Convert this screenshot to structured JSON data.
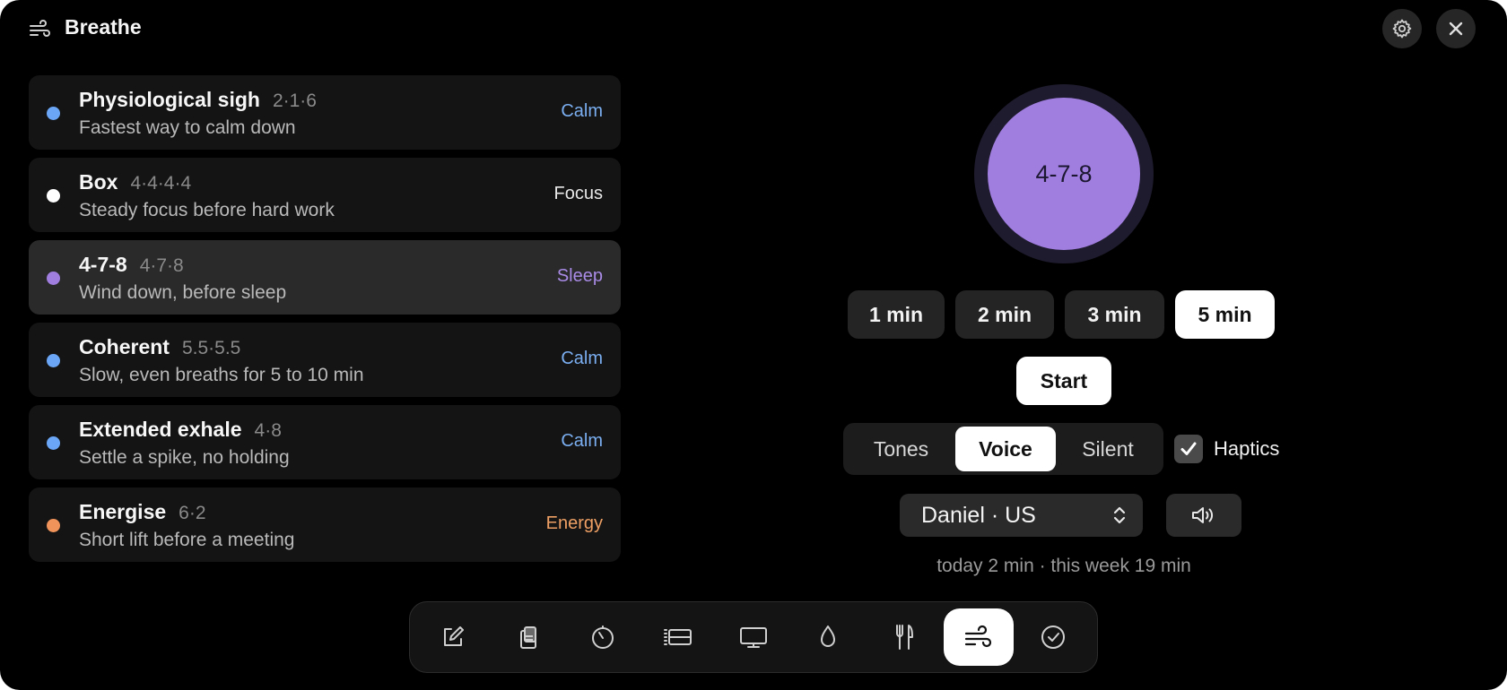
{
  "app": {
    "title": "Breathe",
    "icon": "wind-icon"
  },
  "header": {
    "settings_icon": "gear-icon",
    "close_icon": "close-icon"
  },
  "exercises": [
    {
      "name": "Physiological sigh",
      "pattern": "2·1·6",
      "description": "Fastest way to calm down",
      "tag": "Calm",
      "color": "#6aa6f5",
      "tag_color": "#7aaef0",
      "selected": false
    },
    {
      "name": "Box",
      "pattern": "4·4·4·4",
      "description": "Steady focus before hard work",
      "tag": "Focus",
      "color": "#ffffff",
      "tag_color": "#e8e8e8",
      "selected": false
    },
    {
      "name": "4-7-8",
      "pattern": "4·7·8",
      "description": "Wind down, before sleep",
      "tag": "Sleep",
      "color": "#a07ee0",
      "tag_color": "#a98be6",
      "selected": true
    },
    {
      "name": "Coherent",
      "pattern": "5.5·5.5",
      "description": "Slow, even breaths for 5 to 10 min",
      "tag": "Calm",
      "color": "#6aa6f5",
      "tag_color": "#7aaef0",
      "selected": false
    },
    {
      "name": "Extended exhale",
      "pattern": "4·8",
      "description": "Settle a spike, no holding",
      "tag": "Calm",
      "color": "#6aa6f5",
      "tag_color": "#7aaef0",
      "selected": false
    },
    {
      "name": "Energise",
      "pattern": "6·2",
      "description": "Short lift before a meeting",
      "tag": "Energy",
      "color": "#f0935a",
      "tag_color": "#eea064",
      "selected": false
    }
  ],
  "player": {
    "circle_label": "4-7-8",
    "durations": [
      {
        "label": "1 min",
        "active": false
      },
      {
        "label": "2 min",
        "active": false
      },
      {
        "label": "3 min",
        "active": false
      },
      {
        "label": "5 min",
        "active": true
      }
    ],
    "start_label": "Start",
    "sound_modes": [
      {
        "label": "Tones",
        "active": false
      },
      {
        "label": "Voice",
        "active": true
      },
      {
        "label": "Silent",
        "active": false
      }
    ],
    "haptics": {
      "label": "Haptics",
      "checked": true
    },
    "voice": {
      "selected": "Daniel · US"
    },
    "speaker_icon": "speaker-icon",
    "stats": "today 2 min · this week 19 min"
  },
  "dock": {
    "items": [
      {
        "icon": "compose-icon",
        "active": false
      },
      {
        "icon": "clipboard-icon",
        "active": false
      },
      {
        "icon": "timer-icon",
        "active": false
      },
      {
        "icon": "list-icon",
        "active": false
      },
      {
        "icon": "display-icon",
        "active": false
      },
      {
        "icon": "drop-icon",
        "active": false
      },
      {
        "icon": "utensils-icon",
        "active": false
      },
      {
        "icon": "wind-icon",
        "active": true
      },
      {
        "icon": "check-circle-icon",
        "active": false
      }
    ]
  }
}
